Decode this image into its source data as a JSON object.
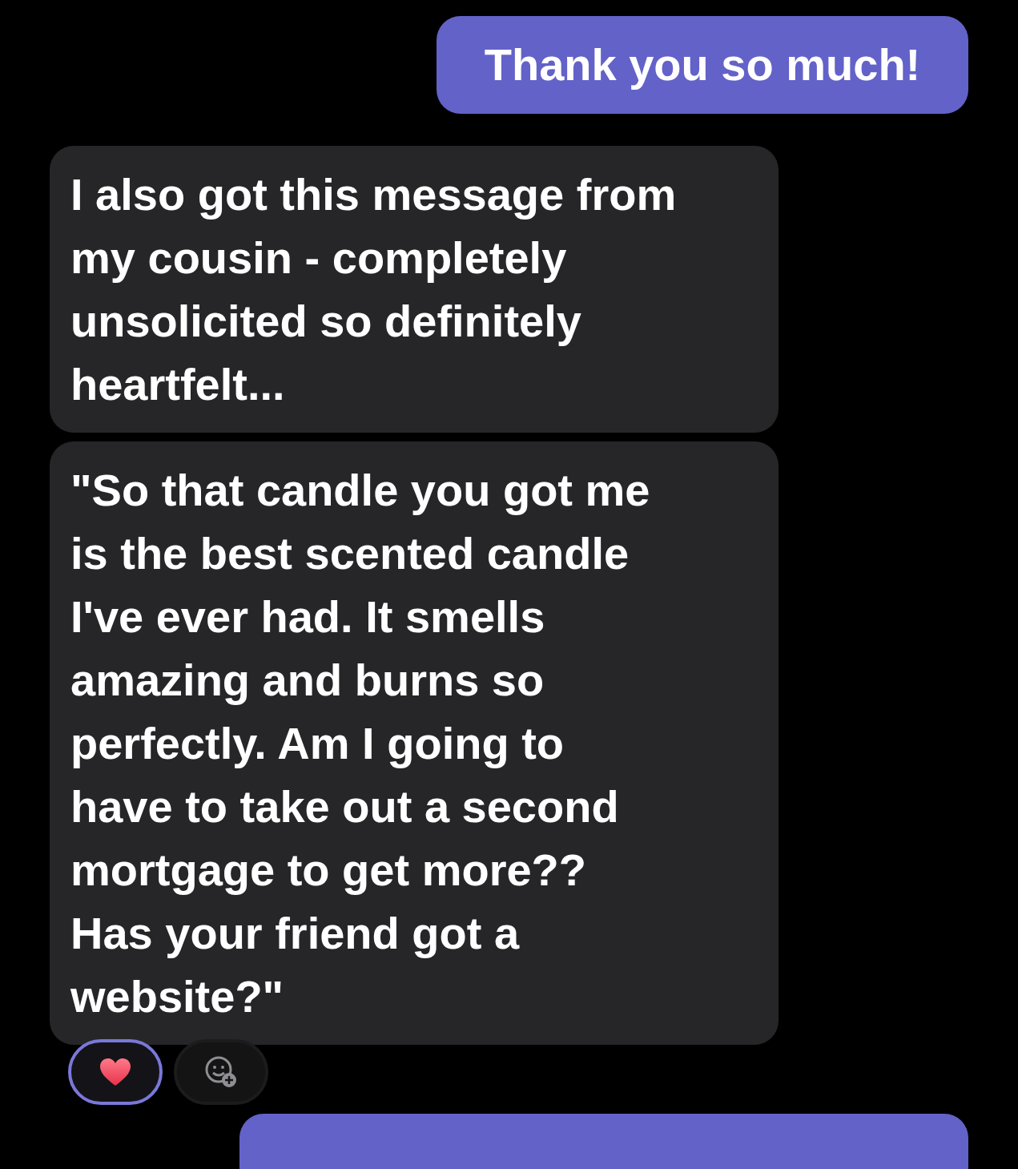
{
  "messages": [
    {
      "kind": "sent",
      "lines": [
        "Thank you so much!"
      ]
    },
    {
      "kind": "received",
      "lines": [
        "I also got this message from",
        "my cousin - completely",
        "unsolicited so definitely",
        "heartfelt..."
      ]
    },
    {
      "kind": "received",
      "lines": [
        "\"So that candle you got me",
        "is the best scented candle",
        "I've ever had. It smells",
        "amazing and burns so",
        "perfectly. Am I going to",
        "have to take out a second",
        "mortgage to get more??",
        "Has your friend got a",
        "website?\""
      ],
      "reactions": [
        {
          "kind": "heart",
          "selected": true
        },
        {
          "kind": "add",
          "selected": false
        }
      ]
    },
    {
      "kind": "sent"
    }
  ]
}
